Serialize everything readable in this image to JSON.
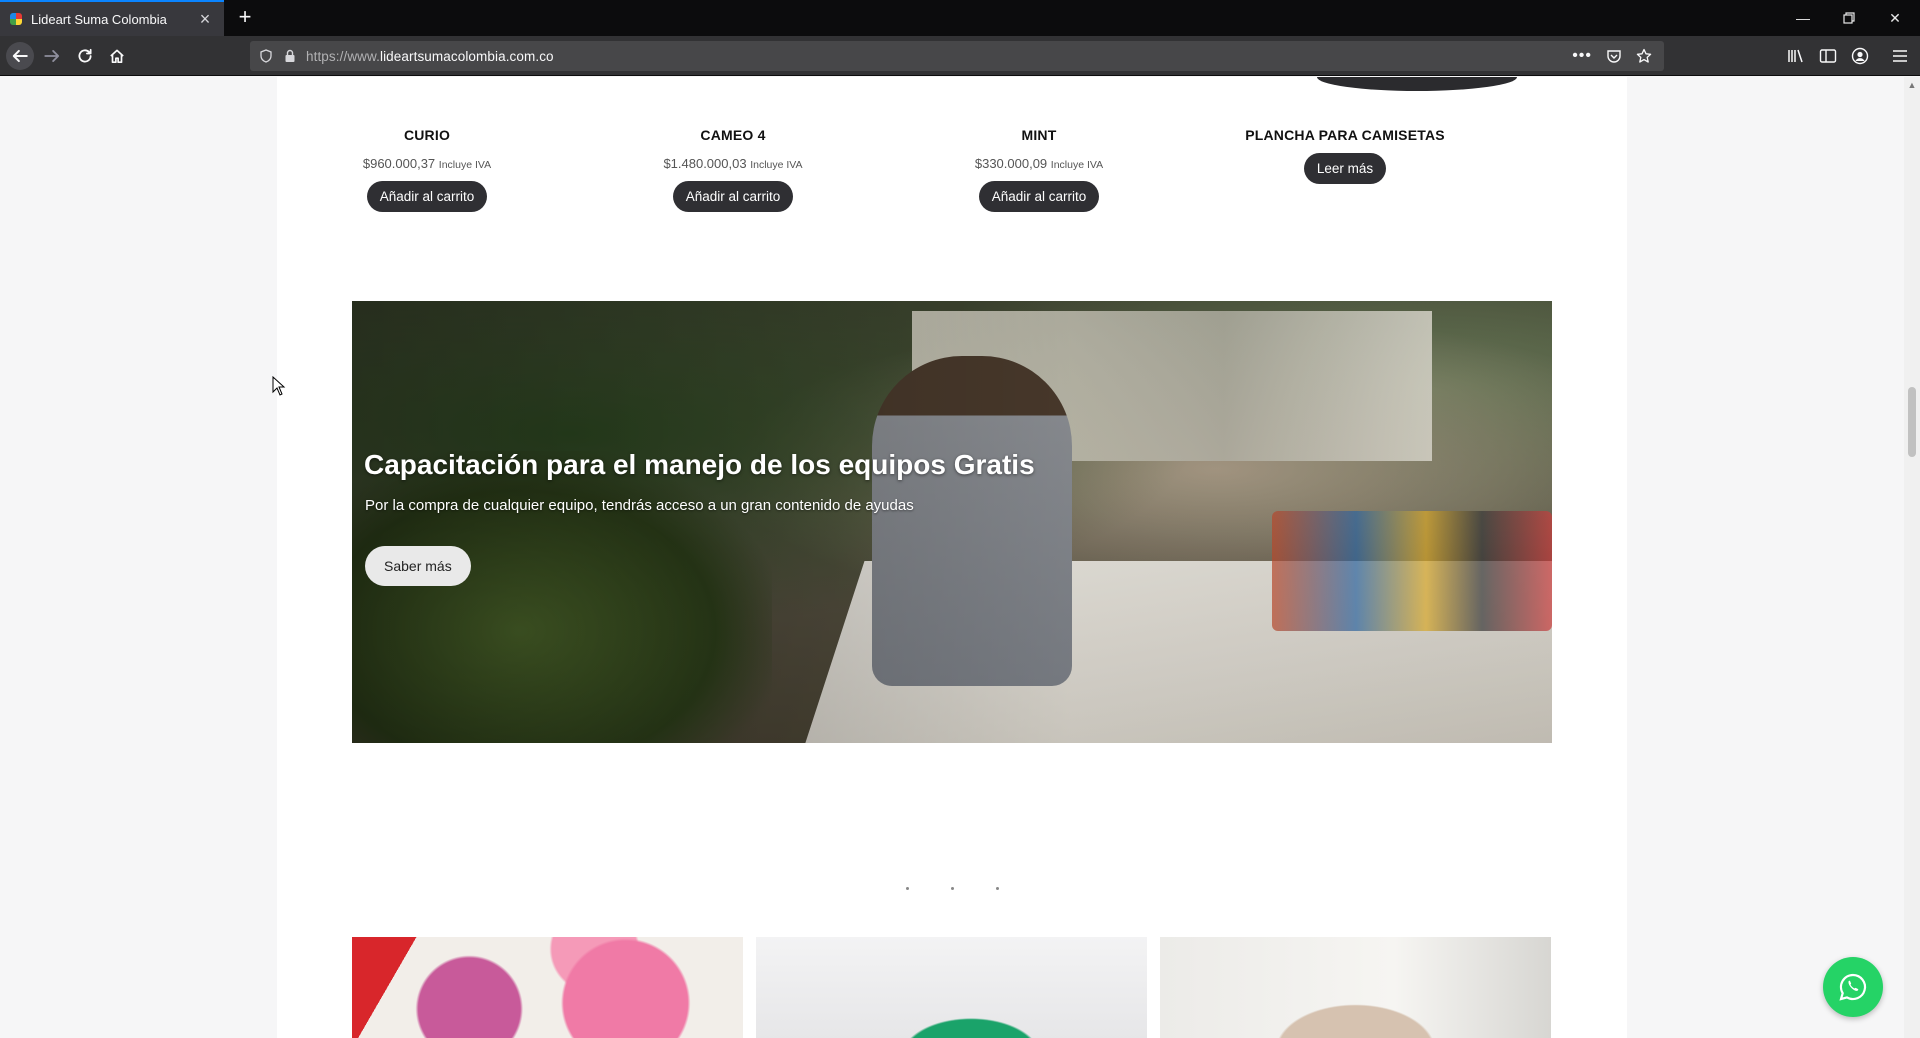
{
  "browser": {
    "tab_title": "Lideart Suma Colombia",
    "url_prefix": "https://www.",
    "url_host": "lideartsumacolombia.com.co"
  },
  "products": [
    {
      "name": "CURIO",
      "price": "$960.000,37",
      "tax_note": "Incluye IVA",
      "button": "Añadir al carrito"
    },
    {
      "name": "CAMEO 4",
      "price": "$1.480.000,03",
      "tax_note": "Incluye IVA",
      "button": "Añadir al carrito"
    },
    {
      "name": "MINT",
      "price": "$330.000,09",
      "tax_note": "Incluye IVA",
      "button": "Añadir al carrito"
    },
    {
      "name": "PLANCHA PARA CAMISETAS",
      "button": "Leer más"
    }
  ],
  "hero": {
    "title": "Capacitación para el manejo de los equipos Gratis",
    "subtitle": "Por la compra de cualquier equipo, tendrás acceso a un gran contenido de ayudas",
    "button": "Saber más"
  },
  "carousel": {
    "slides": 3
  },
  "icons": {
    "back": "back-arrow-icon",
    "forward": "forward-arrow-icon",
    "reload": "reload-icon",
    "home": "home-icon",
    "whatsapp": "whatsapp-icon"
  },
  "colors": {
    "button_dark": "#2f2f33",
    "whatsapp_green": "#25d366",
    "tab_accent": "#0a84ff"
  }
}
